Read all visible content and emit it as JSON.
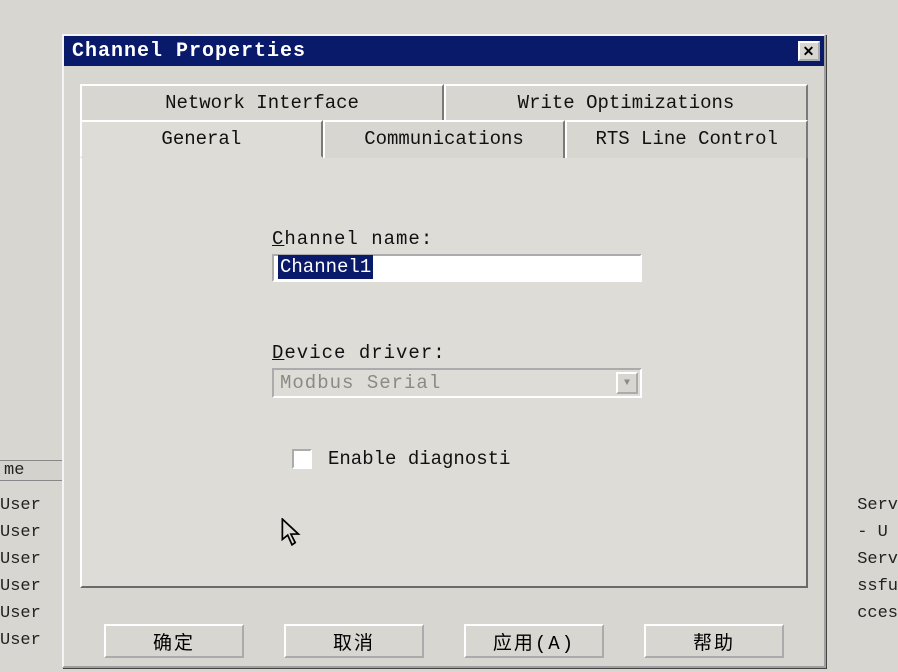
{
  "dialog": {
    "title": "Channel Properties",
    "tabs_back": [
      "Network Interface",
      "Write Optimizations"
    ],
    "tabs_front": [
      "General",
      "Communications",
      "RTS Line Control"
    ],
    "active_tab": "General",
    "channel_name_label_pre": "C",
    "channel_name_label_rest": "hannel name:",
    "channel_name_value": "Channel1",
    "device_driver_label_pre": "D",
    "device_driver_label_rest": "evice driver:",
    "device_driver_value": "Modbus Serial",
    "enable_diag_label_pre": "E",
    "enable_diag_label_rest": "nable diagnosti",
    "enable_diag_checked": false,
    "buttons": {
      "ok": "确定",
      "cancel": "取消",
      "apply": "应用(A)",
      "help": "帮助"
    }
  },
  "background": {
    "left_header": "me",
    "left_rows": [
      "User",
      "User",
      "User",
      "User",
      "User",
      "User"
    ],
    "right_rows": [
      "Serv",
      "- U",
      "Serv",
      "ssfu",
      "cces"
    ]
  }
}
